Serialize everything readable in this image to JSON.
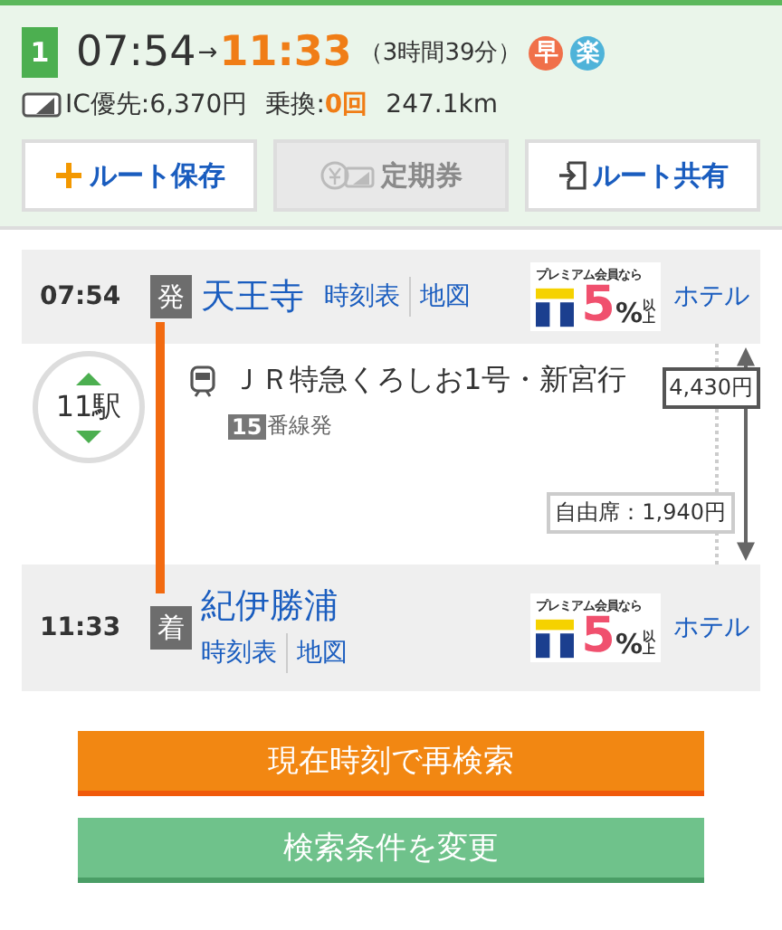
{
  "route": {
    "number": "1",
    "depart": "07:54",
    "arrow": "→",
    "arrive": "11:33",
    "duration": "（3時間39分）",
    "badges": [
      {
        "label": "早",
        "color": "#f0704a"
      },
      {
        "label": "楽",
        "color": "#4fb3d9"
      }
    ],
    "fare": "IC優先:6,370円",
    "transfer_label": "乗換:",
    "transfer_count": "0回",
    "distance": "247.1km"
  },
  "buttons": [
    {
      "kind": "save",
      "label": "ルート保存",
      "disabled": false
    },
    {
      "kind": "pass",
      "label": "定期券",
      "disabled": true
    },
    {
      "kind": "share",
      "label": "ルート共有",
      "disabled": false
    }
  ],
  "departure": {
    "time": "07:54",
    "mark": "発",
    "station": "天王寺",
    "links": [
      "時刻表",
      "地図"
    ],
    "ad": {
      "caption": "プレミアム会員なら",
      "value": "5",
      "unit": "%",
      "suffix": "以上"
    },
    "hotel": "ホテル"
  },
  "segment": {
    "stops": "11駅",
    "train": "ＪＲ特急くろしお1号・新宮行",
    "platform_number": "15",
    "platform_text": "番線発",
    "fare": "4,430円",
    "seat_fare": "自由席：1,940円"
  },
  "arrival": {
    "time": "11:33",
    "mark": "着",
    "station": "紀伊勝浦",
    "links": [
      "時刻表",
      "地図"
    ],
    "ad": {
      "caption": "プレミアム会員なら",
      "value": "5",
      "unit": "%",
      "suffix": "以上"
    },
    "hotel": "ホテル"
  },
  "actions": [
    {
      "kind": "primary",
      "label": "現在時刻で再検索"
    },
    {
      "kind": "secondary",
      "label": "検索条件を変更"
    }
  ]
}
